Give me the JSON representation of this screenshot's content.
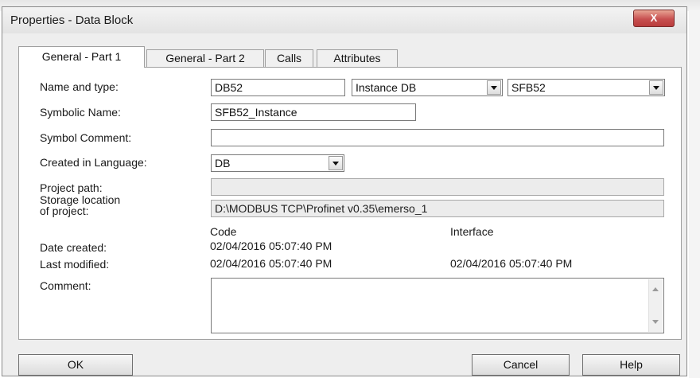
{
  "window": {
    "title": "Properties - Data Block",
    "close_label": "X"
  },
  "tabs": [
    {
      "label": "General - Part 1"
    },
    {
      "label": "General - Part 2"
    },
    {
      "label": "Calls"
    },
    {
      "label": "Attributes"
    }
  ],
  "form": {
    "name_and_type": {
      "label": "Name and type:",
      "name_value": "DB52",
      "type_value": "Instance DB",
      "fb_value": "SFB52"
    },
    "symbolic_name": {
      "label": "Symbolic Name:",
      "value": "SFB52_Instance"
    },
    "symbol_comment": {
      "label": "Symbol Comment:",
      "value": ""
    },
    "created_in_language": {
      "label": "Created in Language:",
      "value": "DB"
    },
    "project_path": {
      "label": "Project path:",
      "value": ""
    },
    "storage_location": {
      "label_line1": "Storage location",
      "label_line2": "of project:",
      "value": "D:\\MODBUS TCP\\Profinet v0.35\\emerso_1"
    },
    "columns": {
      "code": "Code",
      "interface": "Interface"
    },
    "date_created": {
      "label": "Date created:",
      "code": "02/04/2016 05:07:40 PM"
    },
    "last_modified": {
      "label": "Last modified:",
      "code": "02/04/2016 05:07:40 PM",
      "interface": "02/04/2016 05:07:40 PM"
    },
    "comment": {
      "label": "Comment:",
      "value": ""
    }
  },
  "buttons": {
    "ok": "OK",
    "cancel": "Cancel",
    "help": "Help"
  }
}
